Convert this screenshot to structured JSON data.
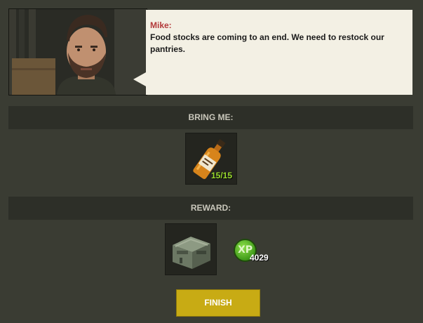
{
  "dialog": {
    "speaker": "Mike:",
    "message": "Food stocks are coming to an end. We need to restock our pantries."
  },
  "bring": {
    "header": "BRING ME:",
    "item": {
      "icon": "whiskey-bottle-icon",
      "count": "15/15"
    }
  },
  "reward": {
    "header": "REWARD:",
    "items": [
      {
        "icon": "supply-crate-icon"
      }
    ],
    "xp": {
      "label": "XP",
      "value": "4029"
    }
  },
  "finish_label": "FINISH",
  "colors": {
    "accent": "#c8ab14",
    "speaker": "#b33a3a",
    "count": "#9bdc2e",
    "xp": "#3f9a19"
  }
}
